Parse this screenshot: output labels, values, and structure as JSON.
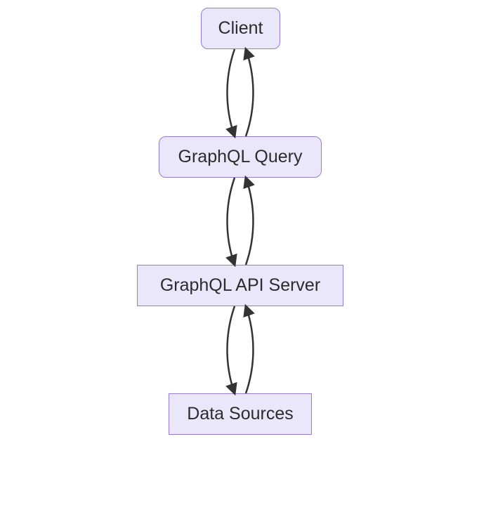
{
  "diagram": {
    "nodes": {
      "client": {
        "label": "Client"
      },
      "query": {
        "label": "GraphQL Query"
      },
      "server": {
        "label": "GraphQL API Server"
      },
      "data": {
        "label": "Data Sources"
      }
    },
    "colors": {
      "node_fill": "#ebe7fb",
      "node_border": "#9779d6",
      "arrow": "#333333"
    },
    "edges": [
      [
        "client",
        "query"
      ],
      [
        "query",
        "server"
      ],
      [
        "server",
        "data"
      ]
    ]
  }
}
